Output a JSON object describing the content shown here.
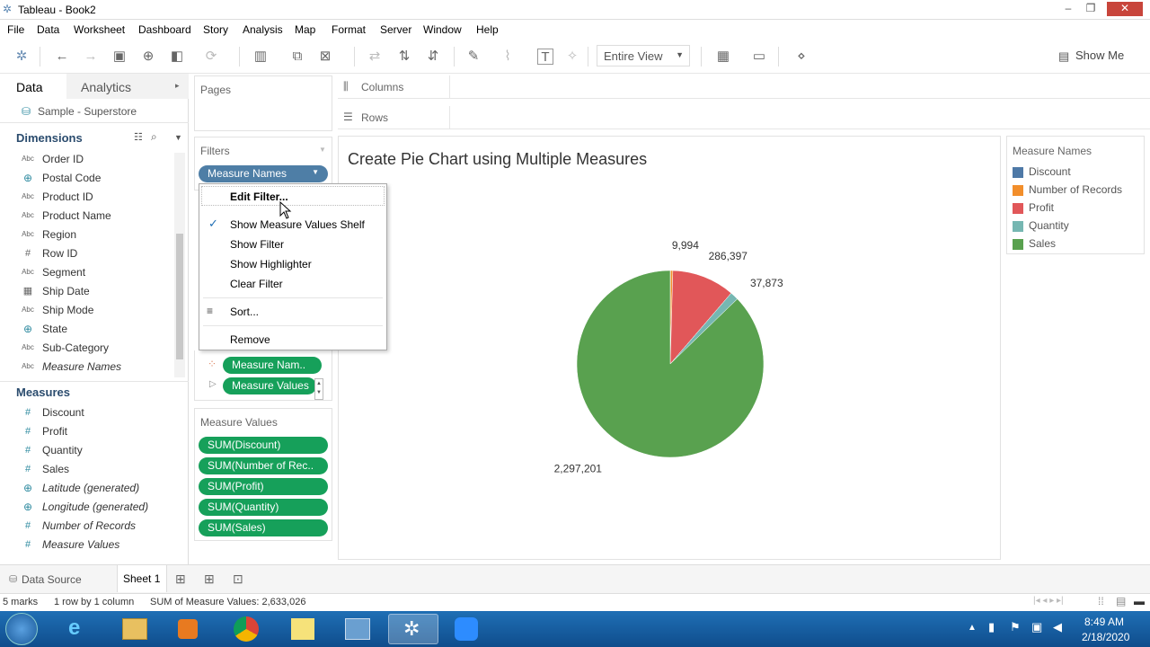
{
  "window": {
    "title": "Tableau - Book2"
  },
  "menubar": [
    "File",
    "Data",
    "Worksheet",
    "Dashboard",
    "Story",
    "Analysis",
    "Map",
    "Format",
    "Server",
    "Window",
    "Help"
  ],
  "toolbar": {
    "view_select": "Entire View",
    "show_me": "Show Me"
  },
  "data_pane": {
    "tab_data": "Data",
    "tab_analytics": "Analytics",
    "datasource": "Sample - Superstore",
    "dimensions_title": "Dimensions",
    "dimensions": [
      {
        "icon": "Abc",
        "label": "Order ID"
      },
      {
        "icon": "globe",
        "label": "Postal Code"
      },
      {
        "icon": "Abc",
        "label": "Product ID"
      },
      {
        "icon": "Abc",
        "label": "Product Name"
      },
      {
        "icon": "Abc",
        "label": "Region"
      },
      {
        "icon": "#",
        "label": "Row ID"
      },
      {
        "icon": "Abc",
        "label": "Segment"
      },
      {
        "icon": "calendar",
        "label": "Ship Date"
      },
      {
        "icon": "Abc",
        "label": "Ship Mode"
      },
      {
        "icon": "globe",
        "label": "State"
      },
      {
        "icon": "Abc",
        "label": "Sub-Category"
      },
      {
        "icon": "Abc",
        "label": "Measure Names"
      }
    ],
    "measures_title": "Measures",
    "measures": [
      {
        "icon": "#",
        "label": "Discount"
      },
      {
        "icon": "#",
        "label": "Profit"
      },
      {
        "icon": "#",
        "label": "Quantity"
      },
      {
        "icon": "#",
        "label": "Sales"
      },
      {
        "icon": "globe",
        "label": "Latitude (generated)"
      },
      {
        "icon": "globe",
        "label": "Longitude (generated)"
      },
      {
        "icon": "#",
        "label": "Number of Records"
      },
      {
        "icon": "#",
        "label": "Measure Values"
      }
    ]
  },
  "shelves": {
    "pages": "Pages",
    "columns": "Columns",
    "rows": "Rows",
    "filters": "Filters",
    "filter_pill": "Measure Names",
    "marks_pill_1": "Measure Nam..",
    "marks_pill_2": "Measure Values",
    "measure_values_title": "Measure Values",
    "measure_values": [
      "SUM(Discount)",
      "SUM(Number of Rec..",
      "SUM(Profit)",
      "SUM(Quantity)",
      "SUM(Sales)"
    ]
  },
  "context_menu": {
    "items": [
      "Edit Filter...",
      "Show Measure Values Shelf",
      "Show Filter",
      "Show Highlighter",
      "Clear Filter",
      "Sort...",
      "Remove"
    ]
  },
  "sheet": {
    "title": "Create Pie Chart using Multiple Measures"
  },
  "chart_data": {
    "type": "pie",
    "title": "Create Pie Chart using Multiple Measures",
    "series": [
      {
        "name": "Discount",
        "value": 1561,
        "color": "#4e79a7"
      },
      {
        "name": "Number of Records",
        "value": 9994,
        "color": "#f28e2b"
      },
      {
        "name": "Profit",
        "value": 286397,
        "color": "#e15759"
      },
      {
        "name": "Quantity",
        "value": 37873,
        "color": "#76b7b2"
      },
      {
        "name": "Sales",
        "value": 2297201,
        "color": "#59a14f"
      }
    ],
    "labels": [
      {
        "series": "Number of Records",
        "text": "9,994"
      },
      {
        "series": "Profit",
        "text": "286,397"
      },
      {
        "series": "Quantity",
        "text": "37,873"
      },
      {
        "series": "Sales",
        "text": "2,297,201"
      }
    ],
    "legend_title": "Measure Names",
    "legend": "right"
  },
  "tabs": {
    "data_source": "Data Source",
    "sheet1": "Sheet 1"
  },
  "status": {
    "marks": "5 marks",
    "rows_cols": "1 row by 1 column",
    "sum": "SUM of Measure Values: 2,633,026"
  },
  "taskbar": {
    "time": "8:49 AM",
    "date": "2/18/2020"
  }
}
